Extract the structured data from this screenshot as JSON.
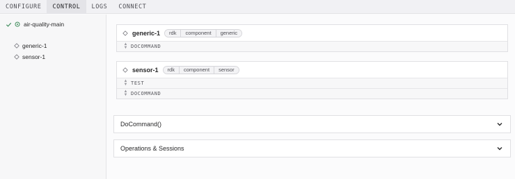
{
  "tabs": [
    {
      "label": "CONFIGURE",
      "active": false
    },
    {
      "label": "CONTROL",
      "active": true
    },
    {
      "label": "LOGS",
      "active": false
    },
    {
      "label": "CONNECT",
      "active": false
    }
  ],
  "sidebar": {
    "root": {
      "label": "air-quality-main",
      "status_icon": "check-icon",
      "icon": "robot-icon"
    },
    "items": [
      {
        "label": "generic-1",
        "icon": "diamond-icon"
      },
      {
        "label": "sensor-1",
        "icon": "diamond-icon"
      }
    ]
  },
  "cards": [
    {
      "title": "generic-1",
      "tags": [
        "rdk",
        "component",
        "generic"
      ],
      "rows": [
        "DOCOMMAND"
      ]
    },
    {
      "title": "sensor-1",
      "tags": [
        "rdk",
        "component",
        "sensor"
      ],
      "rows": [
        "TEST",
        "DOCOMMAND"
      ]
    }
  ],
  "panels": [
    {
      "label": "DoCommand()",
      "icon": "chevron-down-icon"
    },
    {
      "label": "Operations & Sessions",
      "icon": "chevron-down-icon"
    }
  ],
  "colors": {
    "accent_green": "#3d8a5a",
    "border": "#e0e0e3"
  }
}
